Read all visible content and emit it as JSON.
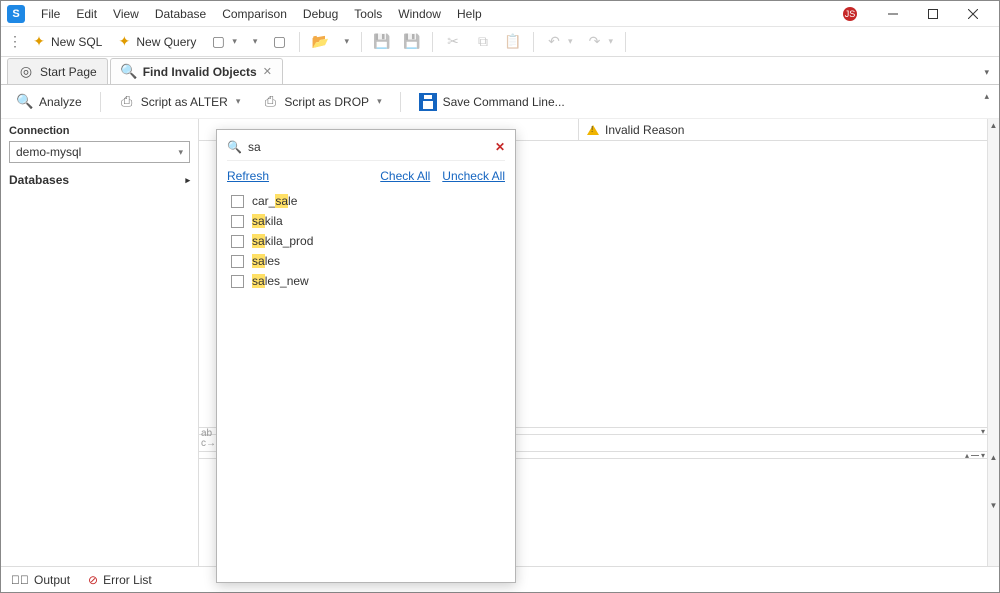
{
  "menu": [
    "File",
    "Edit",
    "View",
    "Database",
    "Comparison",
    "Debug",
    "Tools",
    "Window",
    "Help"
  ],
  "badge": "JS",
  "toolbar": {
    "new_sql": "New SQL",
    "new_query": "New Query"
  },
  "tabs": {
    "start": "Start Page",
    "find": "Find Invalid Objects"
  },
  "actions": {
    "analyze": "Analyze",
    "script_alter": "Script as ALTER",
    "script_drop": "Script as DROP",
    "save_cmd": "Save Command Line..."
  },
  "sidebar": {
    "connection_label": "Connection",
    "connection_value": "demo-mysql",
    "databases_label": "Databases"
  },
  "grid": {
    "invalid_reason": "Invalid Reason"
  },
  "status": {
    "output": "Output",
    "error_list": "Error List"
  },
  "popup": {
    "search_value": "sa",
    "refresh": "Refresh",
    "check_all": "Check All",
    "uncheck_all": "Uncheck All",
    "items": [
      {
        "pre": "car_",
        "hl": "sa",
        "post": "le"
      },
      {
        "pre": "",
        "hl": "sa",
        "post": "kila"
      },
      {
        "pre": "",
        "hl": "sa",
        "post": "kila_prod"
      },
      {
        "pre": "",
        "hl": "sa",
        "post": "les"
      },
      {
        "pre": "",
        "hl": "sa",
        "post": "les_new"
      }
    ]
  }
}
